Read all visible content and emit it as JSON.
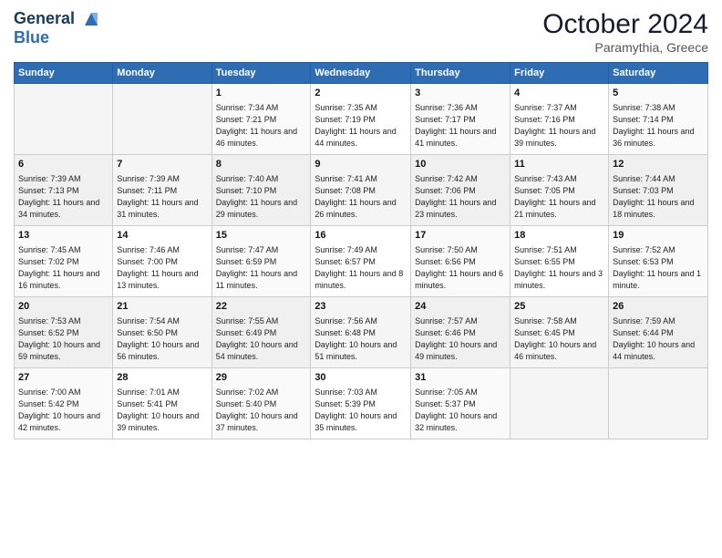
{
  "header": {
    "logo_line1": "General",
    "logo_line2": "Blue",
    "month": "October 2024",
    "location": "Paramythia, Greece"
  },
  "days_of_week": [
    "Sunday",
    "Monday",
    "Tuesday",
    "Wednesday",
    "Thursday",
    "Friday",
    "Saturday"
  ],
  "weeks": [
    [
      {
        "day": "",
        "sunrise": "",
        "sunset": "",
        "daylight": ""
      },
      {
        "day": "",
        "sunrise": "",
        "sunset": "",
        "daylight": ""
      },
      {
        "day": "1",
        "sunrise": "Sunrise: 7:34 AM",
        "sunset": "Sunset: 7:21 PM",
        "daylight": "Daylight: 11 hours and 46 minutes."
      },
      {
        "day": "2",
        "sunrise": "Sunrise: 7:35 AM",
        "sunset": "Sunset: 7:19 PM",
        "daylight": "Daylight: 11 hours and 44 minutes."
      },
      {
        "day": "3",
        "sunrise": "Sunrise: 7:36 AM",
        "sunset": "Sunset: 7:17 PM",
        "daylight": "Daylight: 11 hours and 41 minutes."
      },
      {
        "day": "4",
        "sunrise": "Sunrise: 7:37 AM",
        "sunset": "Sunset: 7:16 PM",
        "daylight": "Daylight: 11 hours and 39 minutes."
      },
      {
        "day": "5",
        "sunrise": "Sunrise: 7:38 AM",
        "sunset": "Sunset: 7:14 PM",
        "daylight": "Daylight: 11 hours and 36 minutes."
      }
    ],
    [
      {
        "day": "6",
        "sunrise": "Sunrise: 7:39 AM",
        "sunset": "Sunset: 7:13 PM",
        "daylight": "Daylight: 11 hours and 34 minutes."
      },
      {
        "day": "7",
        "sunrise": "Sunrise: 7:39 AM",
        "sunset": "Sunset: 7:11 PM",
        "daylight": "Daylight: 11 hours and 31 minutes."
      },
      {
        "day": "8",
        "sunrise": "Sunrise: 7:40 AM",
        "sunset": "Sunset: 7:10 PM",
        "daylight": "Daylight: 11 hours and 29 minutes."
      },
      {
        "day": "9",
        "sunrise": "Sunrise: 7:41 AM",
        "sunset": "Sunset: 7:08 PM",
        "daylight": "Daylight: 11 hours and 26 minutes."
      },
      {
        "day": "10",
        "sunrise": "Sunrise: 7:42 AM",
        "sunset": "Sunset: 7:06 PM",
        "daylight": "Daylight: 11 hours and 23 minutes."
      },
      {
        "day": "11",
        "sunrise": "Sunrise: 7:43 AM",
        "sunset": "Sunset: 7:05 PM",
        "daylight": "Daylight: 11 hours and 21 minutes."
      },
      {
        "day": "12",
        "sunrise": "Sunrise: 7:44 AM",
        "sunset": "Sunset: 7:03 PM",
        "daylight": "Daylight: 11 hours and 18 minutes."
      }
    ],
    [
      {
        "day": "13",
        "sunrise": "Sunrise: 7:45 AM",
        "sunset": "Sunset: 7:02 PM",
        "daylight": "Daylight: 11 hours and 16 minutes."
      },
      {
        "day": "14",
        "sunrise": "Sunrise: 7:46 AM",
        "sunset": "Sunset: 7:00 PM",
        "daylight": "Daylight: 11 hours and 13 minutes."
      },
      {
        "day": "15",
        "sunrise": "Sunrise: 7:47 AM",
        "sunset": "Sunset: 6:59 PM",
        "daylight": "Daylight: 11 hours and 11 minutes."
      },
      {
        "day": "16",
        "sunrise": "Sunrise: 7:49 AM",
        "sunset": "Sunset: 6:57 PM",
        "daylight": "Daylight: 11 hours and 8 minutes."
      },
      {
        "day": "17",
        "sunrise": "Sunrise: 7:50 AM",
        "sunset": "Sunset: 6:56 PM",
        "daylight": "Daylight: 11 hours and 6 minutes."
      },
      {
        "day": "18",
        "sunrise": "Sunrise: 7:51 AM",
        "sunset": "Sunset: 6:55 PM",
        "daylight": "Daylight: 11 hours and 3 minutes."
      },
      {
        "day": "19",
        "sunrise": "Sunrise: 7:52 AM",
        "sunset": "Sunset: 6:53 PM",
        "daylight": "Daylight: 11 hours and 1 minute."
      }
    ],
    [
      {
        "day": "20",
        "sunrise": "Sunrise: 7:53 AM",
        "sunset": "Sunset: 6:52 PM",
        "daylight": "Daylight: 10 hours and 59 minutes."
      },
      {
        "day": "21",
        "sunrise": "Sunrise: 7:54 AM",
        "sunset": "Sunset: 6:50 PM",
        "daylight": "Daylight: 10 hours and 56 minutes."
      },
      {
        "day": "22",
        "sunrise": "Sunrise: 7:55 AM",
        "sunset": "Sunset: 6:49 PM",
        "daylight": "Daylight: 10 hours and 54 minutes."
      },
      {
        "day": "23",
        "sunrise": "Sunrise: 7:56 AM",
        "sunset": "Sunset: 6:48 PM",
        "daylight": "Daylight: 10 hours and 51 minutes."
      },
      {
        "day": "24",
        "sunrise": "Sunrise: 7:57 AM",
        "sunset": "Sunset: 6:46 PM",
        "daylight": "Daylight: 10 hours and 49 minutes."
      },
      {
        "day": "25",
        "sunrise": "Sunrise: 7:58 AM",
        "sunset": "Sunset: 6:45 PM",
        "daylight": "Daylight: 10 hours and 46 minutes."
      },
      {
        "day": "26",
        "sunrise": "Sunrise: 7:59 AM",
        "sunset": "Sunset: 6:44 PM",
        "daylight": "Daylight: 10 hours and 44 minutes."
      }
    ],
    [
      {
        "day": "27",
        "sunrise": "Sunrise: 7:00 AM",
        "sunset": "Sunset: 5:42 PM",
        "daylight": "Daylight: 10 hours and 42 minutes."
      },
      {
        "day": "28",
        "sunrise": "Sunrise: 7:01 AM",
        "sunset": "Sunset: 5:41 PM",
        "daylight": "Daylight: 10 hours and 39 minutes."
      },
      {
        "day": "29",
        "sunrise": "Sunrise: 7:02 AM",
        "sunset": "Sunset: 5:40 PM",
        "daylight": "Daylight: 10 hours and 37 minutes."
      },
      {
        "day": "30",
        "sunrise": "Sunrise: 7:03 AM",
        "sunset": "Sunset: 5:39 PM",
        "daylight": "Daylight: 10 hours and 35 minutes."
      },
      {
        "day": "31",
        "sunrise": "Sunrise: 7:05 AM",
        "sunset": "Sunset: 5:37 PM",
        "daylight": "Daylight: 10 hours and 32 minutes."
      },
      {
        "day": "",
        "sunrise": "",
        "sunset": "",
        "daylight": ""
      },
      {
        "day": "",
        "sunrise": "",
        "sunset": "",
        "daylight": ""
      }
    ]
  ]
}
